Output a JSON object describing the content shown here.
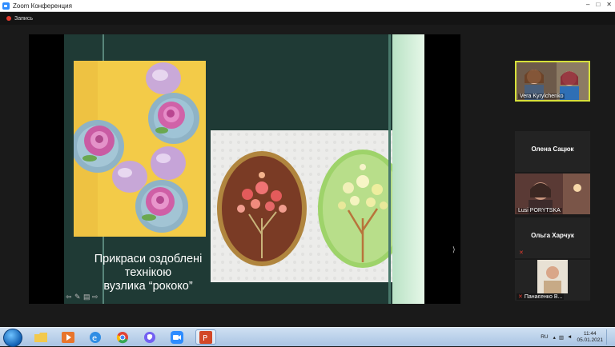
{
  "window": {
    "title": "Zoom Конференция",
    "controls": [
      "–",
      "□",
      "✕"
    ]
  },
  "toolbar": {
    "recording_label": "Запись"
  },
  "slide": {
    "caption_line1": "Прикраси оздоблені",
    "caption_line2": "технікою",
    "caption_line3": "вузлика “рококо”",
    "tools": [
      "⇦",
      "✎",
      "▤",
      "⇨"
    ]
  },
  "participants": [
    {
      "name": "Vera Kyrylchenko",
      "video": true,
      "active": true,
      "muted": false
    },
    {
      "name": "Олена Сацюк",
      "video": false,
      "active": false,
      "muted": false
    },
    {
      "name": "Lusi PORYTSKA",
      "video": true,
      "active": false,
      "muted": false
    },
    {
      "name": "Ольга Харчук",
      "video": false,
      "active": false,
      "muted": true
    },
    {
      "name": "Панаєенко В...",
      "video": true,
      "active": false,
      "muted": true
    }
  ],
  "taskbar": {
    "icons": [
      "folder-icon",
      "media-player-icon",
      "internet-explorer-icon",
      "chrome-icon",
      "viber-icon",
      "zoom-icon",
      "powerpoint-icon"
    ],
    "language": "RU",
    "time": "11:44",
    "date": "05.01.2021"
  },
  "colors": {
    "slide_bg": "#1f3a35",
    "active_speaker_border": "#d6e03a",
    "zoom_blue": "#2d8cff"
  }
}
